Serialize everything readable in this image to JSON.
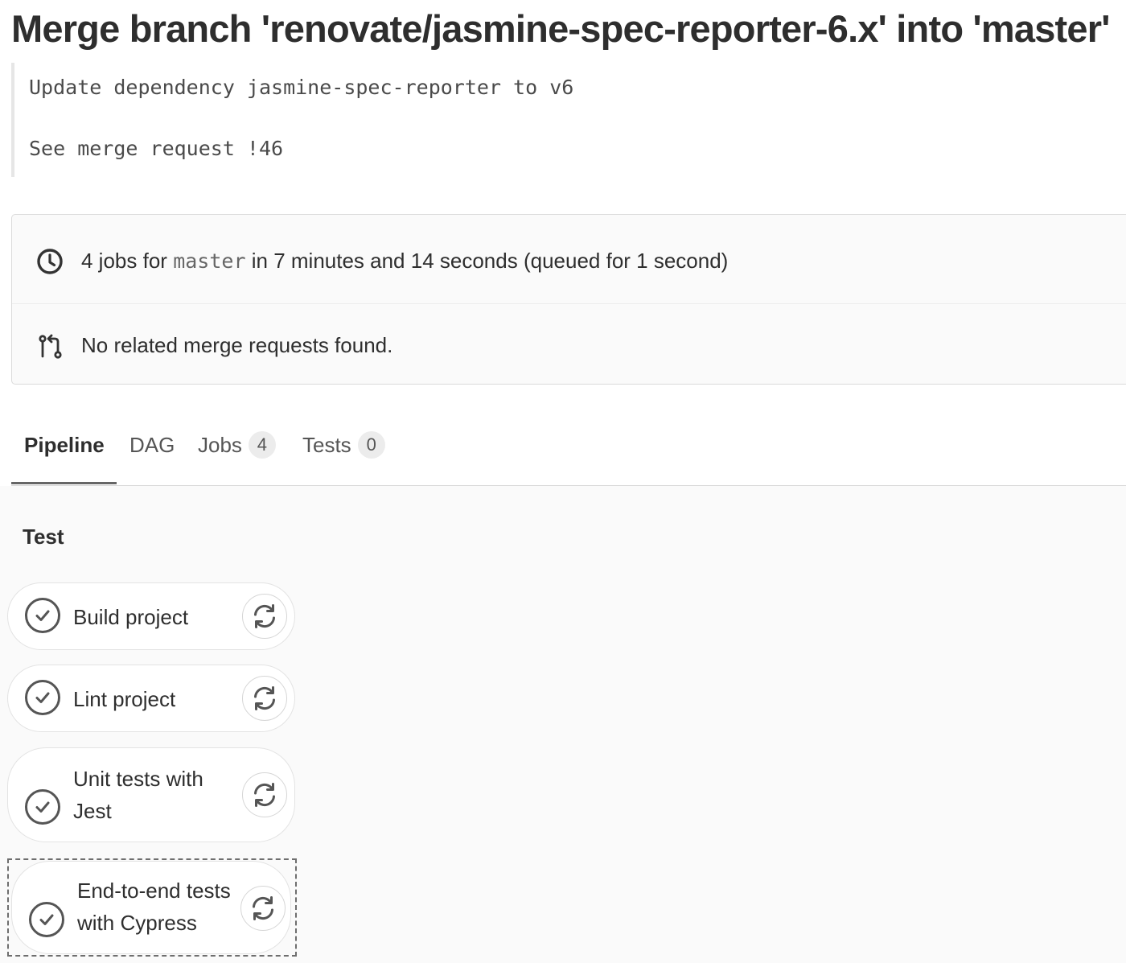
{
  "page": {
    "title": "Merge branch 'renovate/jasmine-spec-reporter-6.x' into 'master'"
  },
  "commit": {
    "description_line1": "Update dependency jasmine-spec-reporter to v6",
    "description_line2": "See merge request !46"
  },
  "info": {
    "jobs_prefix": "4 jobs for",
    "branch": "master",
    "jobs_suffix": "in 7 minutes and 14 seconds (queued for 1 second)",
    "merge_requests": "No related merge requests found.",
    "clock_icon": "clock-icon",
    "merge_icon": "merge-request-icon"
  },
  "tabs": [
    {
      "label": "Pipeline",
      "active": true
    },
    {
      "label": "DAG"
    },
    {
      "label": "Jobs",
      "count": "4"
    },
    {
      "label": "Tests",
      "count": "0"
    }
  ],
  "stage": {
    "title": "Test",
    "jobs": [
      {
        "line1": "Build project",
        "line2": "",
        "status": "success",
        "action_icon": "retry-icon"
      },
      {
        "line1": "Lint project",
        "line2": "",
        "status": "success",
        "action_icon": "retry-icon"
      },
      {
        "line1": "Unit tests with",
        "line2": "Jest",
        "status": "success",
        "action_icon": "retry-icon"
      },
      {
        "line1": "End-to-end tests",
        "line2": "with Cypress",
        "status": "success",
        "action_icon": "retry-icon",
        "highlighted": true
      }
    ]
  },
  "colors": {
    "text": "#2e2e2e",
    "muted": "#666666",
    "border": "#dbdbdb",
    "panel_bg": "#fafafa"
  }
}
